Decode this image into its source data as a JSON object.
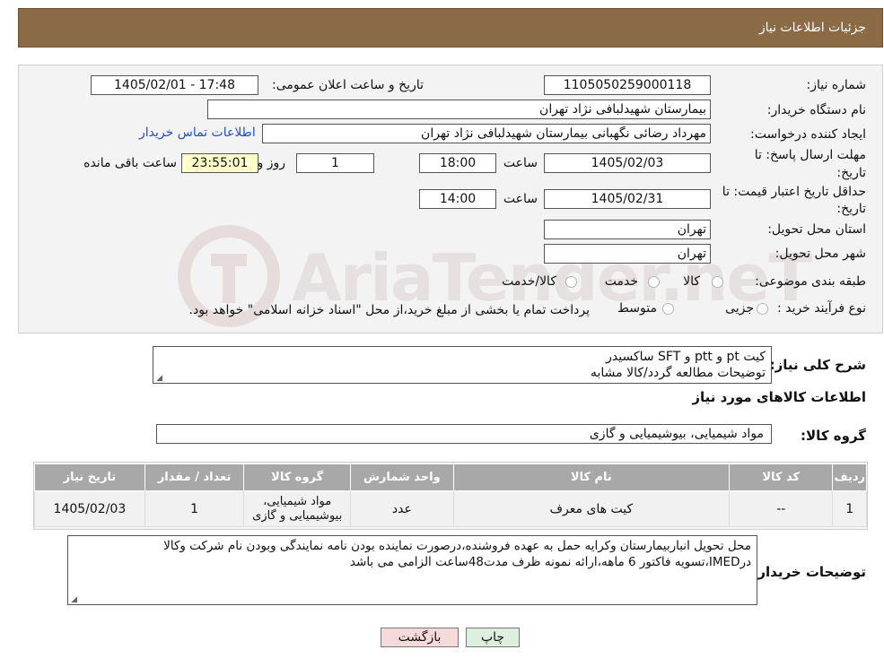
{
  "header": {
    "title": "جزئیات اطلاعات نیاز"
  },
  "fields": {
    "need_number_label": "شماره نیاز:",
    "need_number": "1105050259000118",
    "announce_label": "تاریخ و ساعت اعلان عمومی:",
    "announce_value": "1405/02/01 - 17:48",
    "buyer_org_label": "نام دستگاه خریدار:",
    "buyer_org": "بیمارستان شهیدلبافی نژاد تهران",
    "creator_label": "ایجاد کننده درخواست:",
    "creator": "مهرداد رضائی نگهبانی بیمارستان شهیدلبافی نژاد تهران",
    "contact_link": "اطلاعات تماس خریدار",
    "deadline_label_line1": "مهلت ارسال پاسخ: تا",
    "deadline_label_line2": "تاریخ:",
    "deadline_date": "1405/02/03",
    "time_label": "ساعت",
    "deadline_time": "18:00",
    "days_value": "1",
    "days_label": "روز و",
    "remaining_time": "23:55:01",
    "remaining_label": "ساعت باقی مانده",
    "validity_label_line1": "حداقل تاریخ اعتبار قیمت: تا",
    "validity_label_line2": "تاریخ:",
    "validity_date": "1405/02/31",
    "validity_time": "14:00",
    "province_label": "استان محل تحویل:",
    "province": "تهران",
    "city_label": "شهر محل تحویل:",
    "city": "تهران",
    "category_label": "طبقه بندی موضوعی:",
    "category_options": [
      "کالا",
      "خدمت",
      "کالا/خدمت"
    ],
    "purchase_type_label": "نوع فرآیند خرید :",
    "purchase_type_options": [
      "جزیی",
      "متوسط"
    ],
    "purchase_note": "پرداخت تمام یا بخشی از مبلغ خرید،از محل \"اسناد خزانه اسلامی\" خواهد بود."
  },
  "watermark": {
    "text": "AriaTender.neT"
  },
  "summary": {
    "label": "شرح کلی نیاز:",
    "line1": "کیت pt  و ptt و SFT ساکسیدر",
    "line2": "توضیحات  مطالعه گردد/کالا مشابه"
  },
  "goods_section_title": "اطلاعات کالاهای مورد نیاز",
  "goods_group": {
    "label": "گروه کالا:",
    "value": "مواد شیمیایی، بیوشیمیایی و  گازی"
  },
  "table": {
    "headers": [
      "ردیف",
      "کد کالا",
      "نام کالا",
      "واحد شمارش",
      "گروه کالا",
      "تعداد / مقدار",
      "تاریخ نیاز"
    ],
    "rows": [
      {
        "row": "1",
        "code": "--",
        "name": "کیت های معرف",
        "unit": "عدد",
        "group_line1": "مواد شیمیایی،",
        "group_line2": "بیوشیمیایی و گازی",
        "qty": "1",
        "date": "1405/02/03"
      }
    ]
  },
  "buyer_notes": {
    "label": "توضیحات خریدار:",
    "line1": "محل تحویل انباربیمارستان وکرایه حمل به عهده فروشنده،درصورت نماینده بودن نامه نمایندگی وبودن نام شرکت وکالا",
    "line2": "درIMED،تسویه فاکتور 6 ماهه،ارائه نمونه ظرف مدت48ساعت الزامی می باشد"
  },
  "buttons": {
    "print": "چاپ",
    "back": "بازگشت"
  }
}
